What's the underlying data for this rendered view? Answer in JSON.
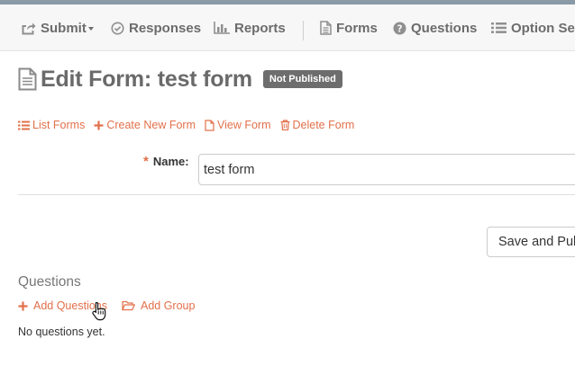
{
  "navbar": {
    "items": [
      {
        "label": "Submit",
        "icon": "share-icon"
      },
      {
        "label": "Responses",
        "icon": "check-circle-icon"
      },
      {
        "label": "Reports",
        "icon": "bar-chart-icon"
      },
      {
        "label": "Forms",
        "icon": "document-icon"
      },
      {
        "label": "Questions",
        "icon": "question-circle-icon"
      },
      {
        "label": "Option Set",
        "icon": "list-icon"
      }
    ]
  },
  "header": {
    "title": "Edit Form: test form",
    "status_badge": "Not Published"
  },
  "actions": {
    "list_forms": "List Forms",
    "create_new_form": "Create New Form",
    "view_form": "View Form",
    "delete_form": "Delete Form"
  },
  "form": {
    "name_label": "Name:",
    "name_value": "test form",
    "save_button": "Save and Publish"
  },
  "questions": {
    "heading": "Questions",
    "add_questions": "Add Questions",
    "add_group": "Add Group",
    "empty_message": "No questions yet."
  },
  "colors": {
    "accent": "#e2704a",
    "badge_bg": "#6d6d6d",
    "nav_bg": "#f7f7f7",
    "top_strip": "#8a9aa6"
  }
}
